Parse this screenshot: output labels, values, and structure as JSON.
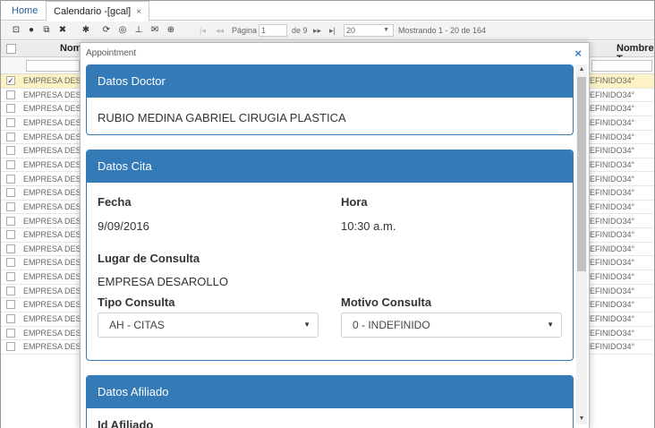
{
  "tabs": {
    "home": "Home",
    "active": "Calendario -[gcal]",
    "close": "×"
  },
  "toolbar": {
    "icons": [
      "print-icon",
      "clock-icon",
      "copy-icon",
      "delete-icon",
      "settings-icon",
      "refresh-icon",
      "comment-icon",
      "pin-icon",
      "mail-icon",
      "add-icon"
    ],
    "page_label": "Página",
    "page_value": "1",
    "of_label": "de 9",
    "rows_per_page": "20",
    "showing": "Mostrando 1 - 20 de 164"
  },
  "grid": {
    "col_name": "Nom",
    "col_right": "Nombre T",
    "rows": [
      {
        "left": "EMPRESA DESA",
        "right": "EFINIDO34°",
        "selected": true
      },
      {
        "left": "EMPRESA DESA",
        "right": "EFINIDO34°"
      },
      {
        "left": "EMPRESA DESA",
        "right": "EFINIDO34°"
      },
      {
        "left": "EMPRESA DESA",
        "right": "EFINIDO34°"
      },
      {
        "left": "EMPRESA DESA",
        "right": "EFINIDO34°"
      },
      {
        "left": "EMPRESA DESA",
        "right": "EFINIDO34°"
      },
      {
        "left": "EMPRESA DESA",
        "right": "EFINIDO34°"
      },
      {
        "left": "EMPRESA DESA",
        "right": "EFINIDO34°"
      },
      {
        "left": "EMPRESA DESA",
        "right": "EFINIDO34°"
      },
      {
        "left": "EMPRESA DESA",
        "right": "EFINIDO34°"
      },
      {
        "left": "EMPRESA DESA",
        "right": "EFINIDO34°"
      },
      {
        "left": "EMPRESA DESA",
        "right": "EFINIDO34°"
      },
      {
        "left": "EMPRESA DESA",
        "right": "EFINIDO34°"
      },
      {
        "left": "EMPRESA DESA",
        "right": "EFINIDO34°"
      },
      {
        "left": "EMPRESA DESA",
        "right": "EFINIDO34°"
      },
      {
        "left": "EMPRESA DESA",
        "right": "EFINIDO34°"
      },
      {
        "left": "EMPRESA DESA",
        "right": "EFINIDO34°"
      },
      {
        "left": "EMPRESA DESA",
        "right": "EFINIDO34°"
      },
      {
        "left": "EMPRESA DESA",
        "right": "EFINIDO34°"
      },
      {
        "left": "EMPRESA DESA",
        "right": "EFINIDO34°"
      }
    ]
  },
  "modal": {
    "title": "Appointment",
    "close": "×",
    "doctor": {
      "heading": "Datos Doctor",
      "name": "RUBIO MEDINA GABRIEL CIRUGIA PLASTICA"
    },
    "cita": {
      "heading": "Datos Cita",
      "fecha_label": "Fecha",
      "fecha_value": "9/09/2016",
      "hora_label": "Hora",
      "hora_value": "10:30 a.m.",
      "lugar_label": "Lugar de Consulta",
      "lugar_value": "EMPRESA DESAROLLO",
      "tipo_label": "Tipo Consulta",
      "tipo_value": "AH - CITAS",
      "motivo_label": "Motivo Consulta",
      "motivo_value": "0 - INDEFINIDO"
    },
    "afiliado": {
      "heading": "Datos Afiliado",
      "id_label": "Id Afiliado"
    }
  },
  "colors": {
    "primary": "#337ab7",
    "selected_row": "#fdf2c3"
  }
}
